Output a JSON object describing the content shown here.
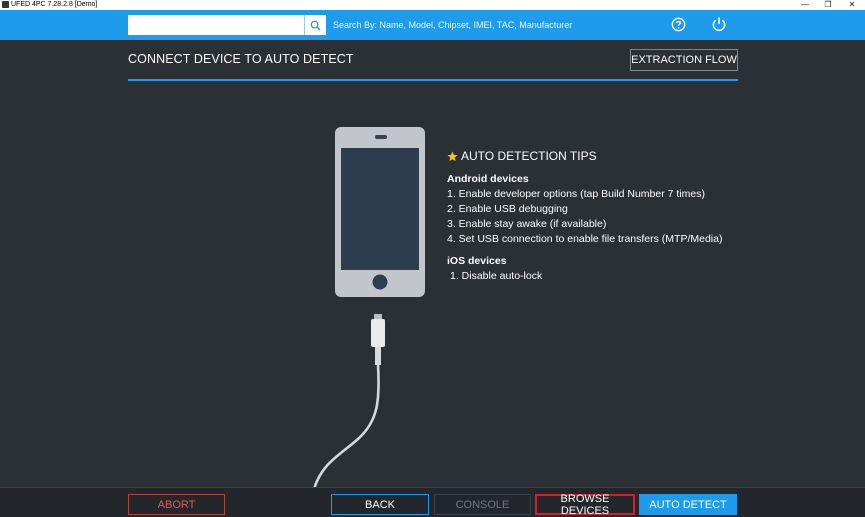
{
  "window": {
    "title": "UFED 4PC 7.28.2.8 [Demo]",
    "minimize_glyph": "—",
    "restore_glyph": "❐",
    "close_glyph": "✕"
  },
  "topbar": {
    "search_value": "",
    "search_hint": "Search By: Name, Model, Chipset, IMEI, TAC, Manufacturer",
    "icons": [
      "search-icon",
      "help-icon",
      "power-icon"
    ],
    "accent_color": "#1e9bea"
  },
  "main": {
    "title": "CONNECT DEVICE TO AUTO DETECT",
    "extraction_flow_label": "EXTRACTION FLOW"
  },
  "tips": {
    "title": "AUTO DETECTION TIPS",
    "icon": "star-icon",
    "android": {
      "heading": "Android devices",
      "steps": [
        "1. Enable developer options (tap Build Number 7 times)",
        "2. Enable USB debugging",
        "3. Enable stay awake (if available)",
        "4. Set USB connection to enable file transfers (MTP/Media)"
      ]
    },
    "ios": {
      "heading": "iOS devices",
      "steps": [
        "1. Disable auto-lock"
      ]
    }
  },
  "footer": {
    "abort_label": "ABORT",
    "back_label": "BACK",
    "console_label": "CONSOLE",
    "browse_label": "BROWSE DEVICES",
    "auto_detect_label": "AUTO DETECT",
    "abort_color": "#e25a4e",
    "highlight_color": "#d91c2a"
  }
}
